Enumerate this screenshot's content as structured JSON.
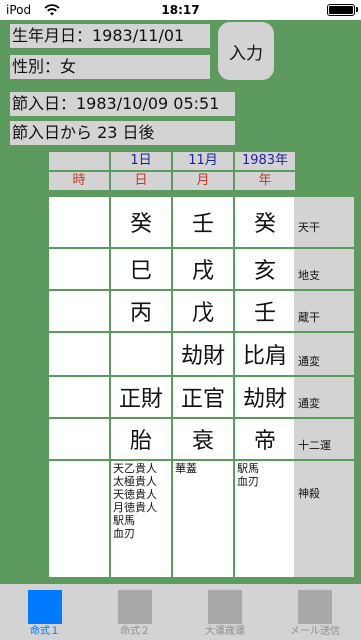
{
  "status_bar": {
    "carrier": "iPod",
    "time": "18:17",
    "battery_level": 1.0
  },
  "form": {
    "birth_date": "生年月日：1983/11/01",
    "gender": "性別：女",
    "input_button": "入力"
  },
  "setsu": {
    "setsu_date": "節入日：1983/10/09 05:51",
    "days_after": "節入日から 23 日後"
  },
  "table": {
    "header_values": [
      "",
      "1日",
      "11月",
      "1983年"
    ],
    "header_labels": [
      "時",
      "日",
      "月",
      "年"
    ],
    "rows": [
      {
        "label": "天干",
        "cells": [
          "",
          "癸",
          "壬",
          "癸"
        ]
      },
      {
        "label": "地支",
        "cells": [
          "",
          "巳",
          "戌",
          "亥"
        ]
      },
      {
        "label": "蔵干",
        "cells": [
          "",
          "丙",
          "戊",
          "壬"
        ]
      },
      {
        "label": "通変",
        "cells": [
          "",
          "",
          "劫財",
          "比肩"
        ]
      },
      {
        "label": "通変",
        "cells": [
          "",
          "正財",
          "正官",
          "劫財"
        ]
      },
      {
        "label": "十二運",
        "cells": [
          "",
          "胎",
          "衰",
          "帝"
        ]
      }
    ],
    "shinsatsu_label": "神殺",
    "shinsatsu": [
      "",
      "天乙貴人\n太極貴人\n天徳貴人\n月徳貴人\n駅馬\n血刃",
      "華蓋",
      "駅馬\n血刃"
    ]
  },
  "tabs": [
    {
      "label": "命式１",
      "active": true
    },
    {
      "label": "命式２",
      "active": false
    },
    {
      "label": "大運歳運",
      "active": false
    },
    {
      "label": "メール送信",
      "active": false
    }
  ],
  "colors": {
    "background": "#5d9a5d",
    "panel": "#d3d3d3",
    "accent": "#007aff",
    "header_blue": "#1f1fa0",
    "header_red": "#c0392b"
  }
}
